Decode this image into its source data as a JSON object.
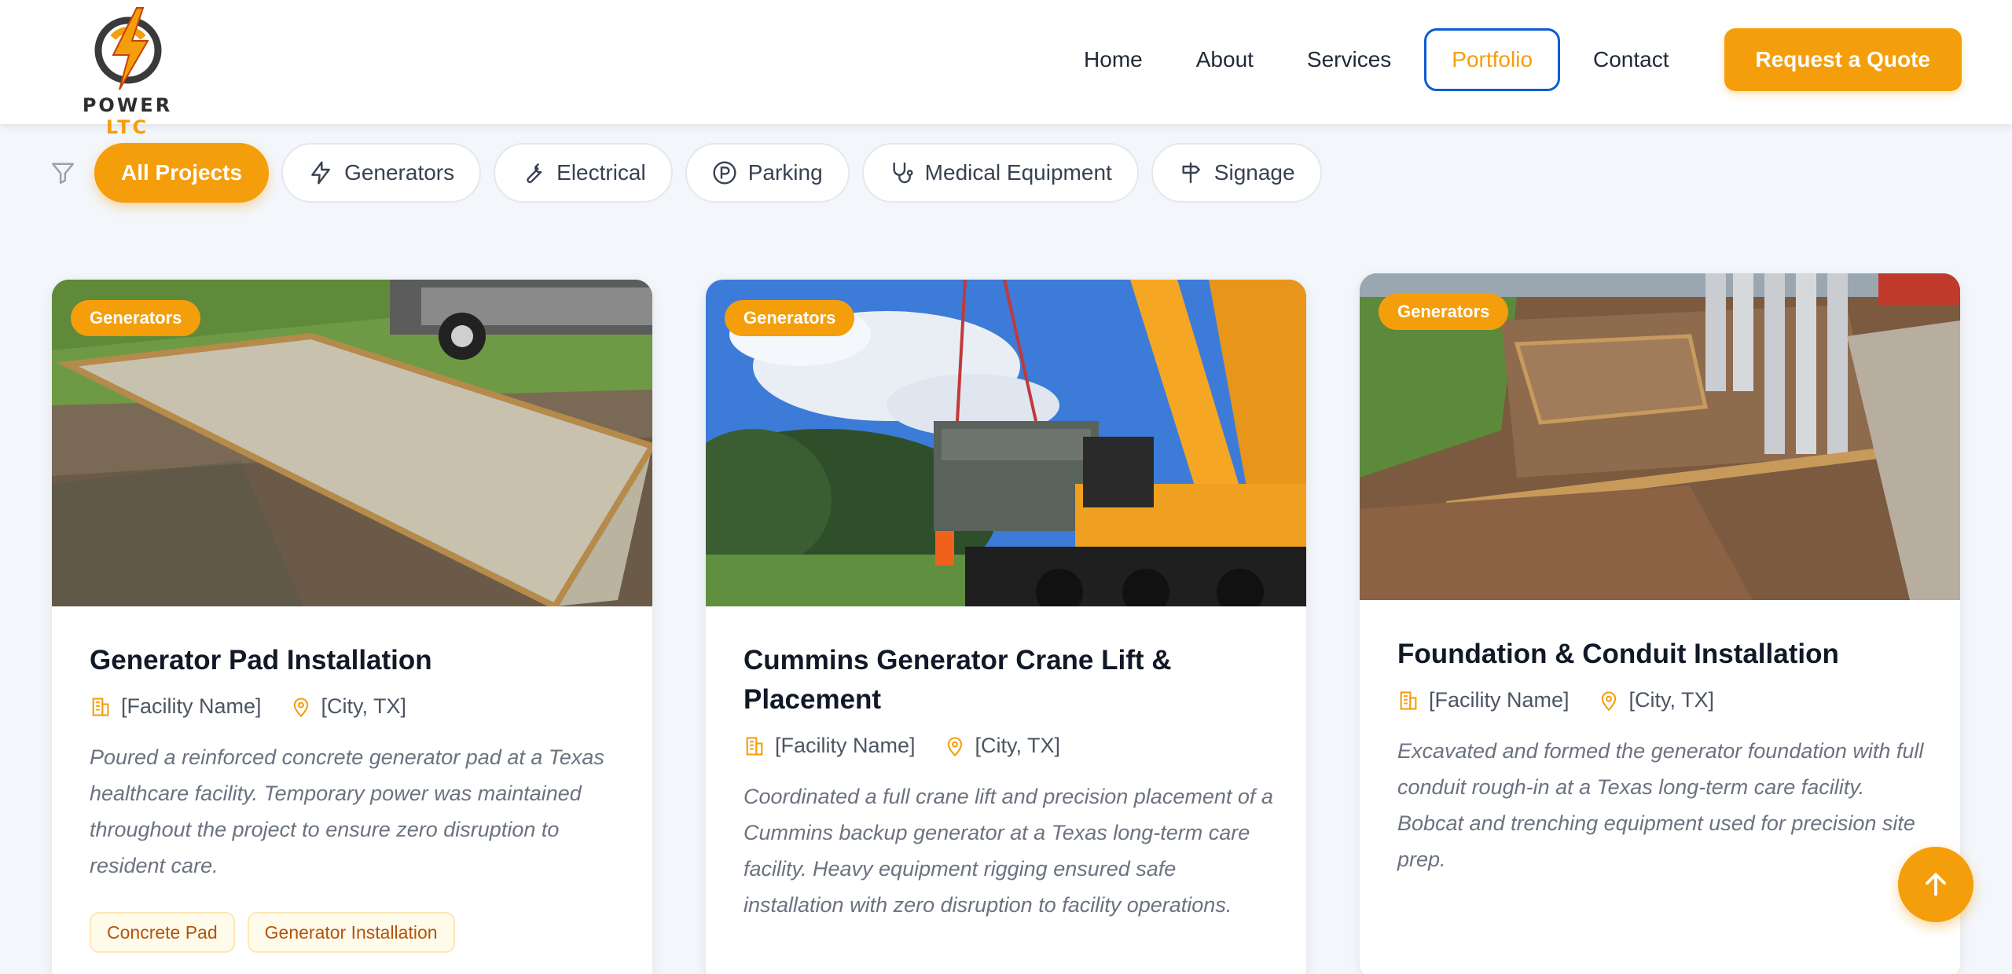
{
  "brand": {
    "name_part1": "POWER",
    "name_part2": "LTC"
  },
  "nav": {
    "items": [
      {
        "label": "Home"
      },
      {
        "label": "About"
      },
      {
        "label": "Services"
      },
      {
        "label": "Portfolio",
        "active": true
      },
      {
        "label": "Contact"
      }
    ],
    "cta_label": "Request a Quote"
  },
  "filters": [
    {
      "label": "All Projects",
      "icon": "none",
      "active": true
    },
    {
      "label": "Generators",
      "icon": "lightning-icon"
    },
    {
      "label": "Electrical",
      "icon": "wrench-icon"
    },
    {
      "label": "Parking",
      "icon": "parking-icon"
    },
    {
      "label": "Medical Equipment",
      "icon": "stethoscope-icon"
    },
    {
      "label": "Signage",
      "icon": "signpost-icon"
    }
  ],
  "projects": [
    {
      "badge": "Generators",
      "title": "Generator Pad Installation",
      "facility": "[Facility Name]",
      "location": "[City, TX]",
      "description": "Poured a reinforced concrete generator pad at a Texas healthcare facility. Temporary power was maintained throughout the project to ensure zero disruption to resident care.",
      "tags": [
        "Concrete Pad",
        "Generator Installation"
      ]
    },
    {
      "badge": "Generators",
      "title": "Cummins Generator Crane Lift & Placement",
      "facility": "[Facility Name]",
      "location": "[City, TX]",
      "description": "Coordinated a full crane lift and precision placement of a Cummins backup generator at a Texas long-term care facility. Heavy equipment rigging ensured safe installation with zero disruption to facility operations.",
      "tags": []
    },
    {
      "badge": "Generators",
      "title": "Foundation & Conduit Installation",
      "facility": "[Facility Name]",
      "location": "[City, TX]",
      "description": "Excavated and formed the generator foundation with full conduit rough-in at a Texas long-term care facility. Bobcat and trenching equipment used for precision site prep.",
      "tags": []
    }
  ],
  "colors": {
    "accent": "#f59e0b",
    "active_border": "#0b5bd3",
    "title": "#111827",
    "muted": "#6b7280"
  }
}
